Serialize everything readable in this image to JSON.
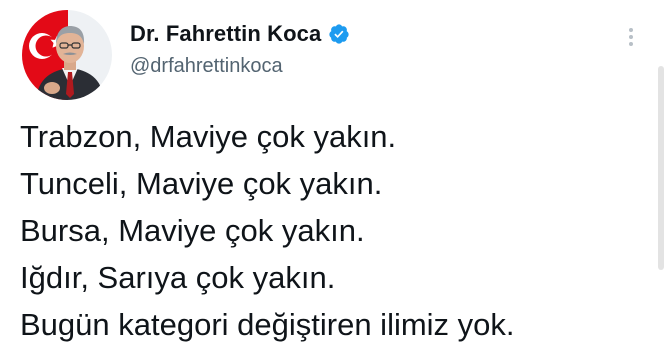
{
  "author": {
    "display_name": "Dr. Fahrettin Koca",
    "handle": "@drfahrettinkoca",
    "verified": true,
    "avatar_icon": "profile-photo",
    "verified_icon": "verified-badge-icon"
  },
  "menu": {
    "icon": "more-vertical-icon"
  },
  "tweet": {
    "lines": [
      "Trabzon, Maviye çok yakın.",
      "Tunceli, Maviye çok yakın.",
      "Bursa, Maviye çok yakın.",
      "Iğdır, Sarıya çok yakın.",
      "Bugün kategori değiştiren ilimiz yok."
    ]
  },
  "colors": {
    "verified_blue": "#1d9bf0",
    "text_primary": "#0f1419",
    "text_secondary": "#536471",
    "flag_red": "#e30a17"
  }
}
